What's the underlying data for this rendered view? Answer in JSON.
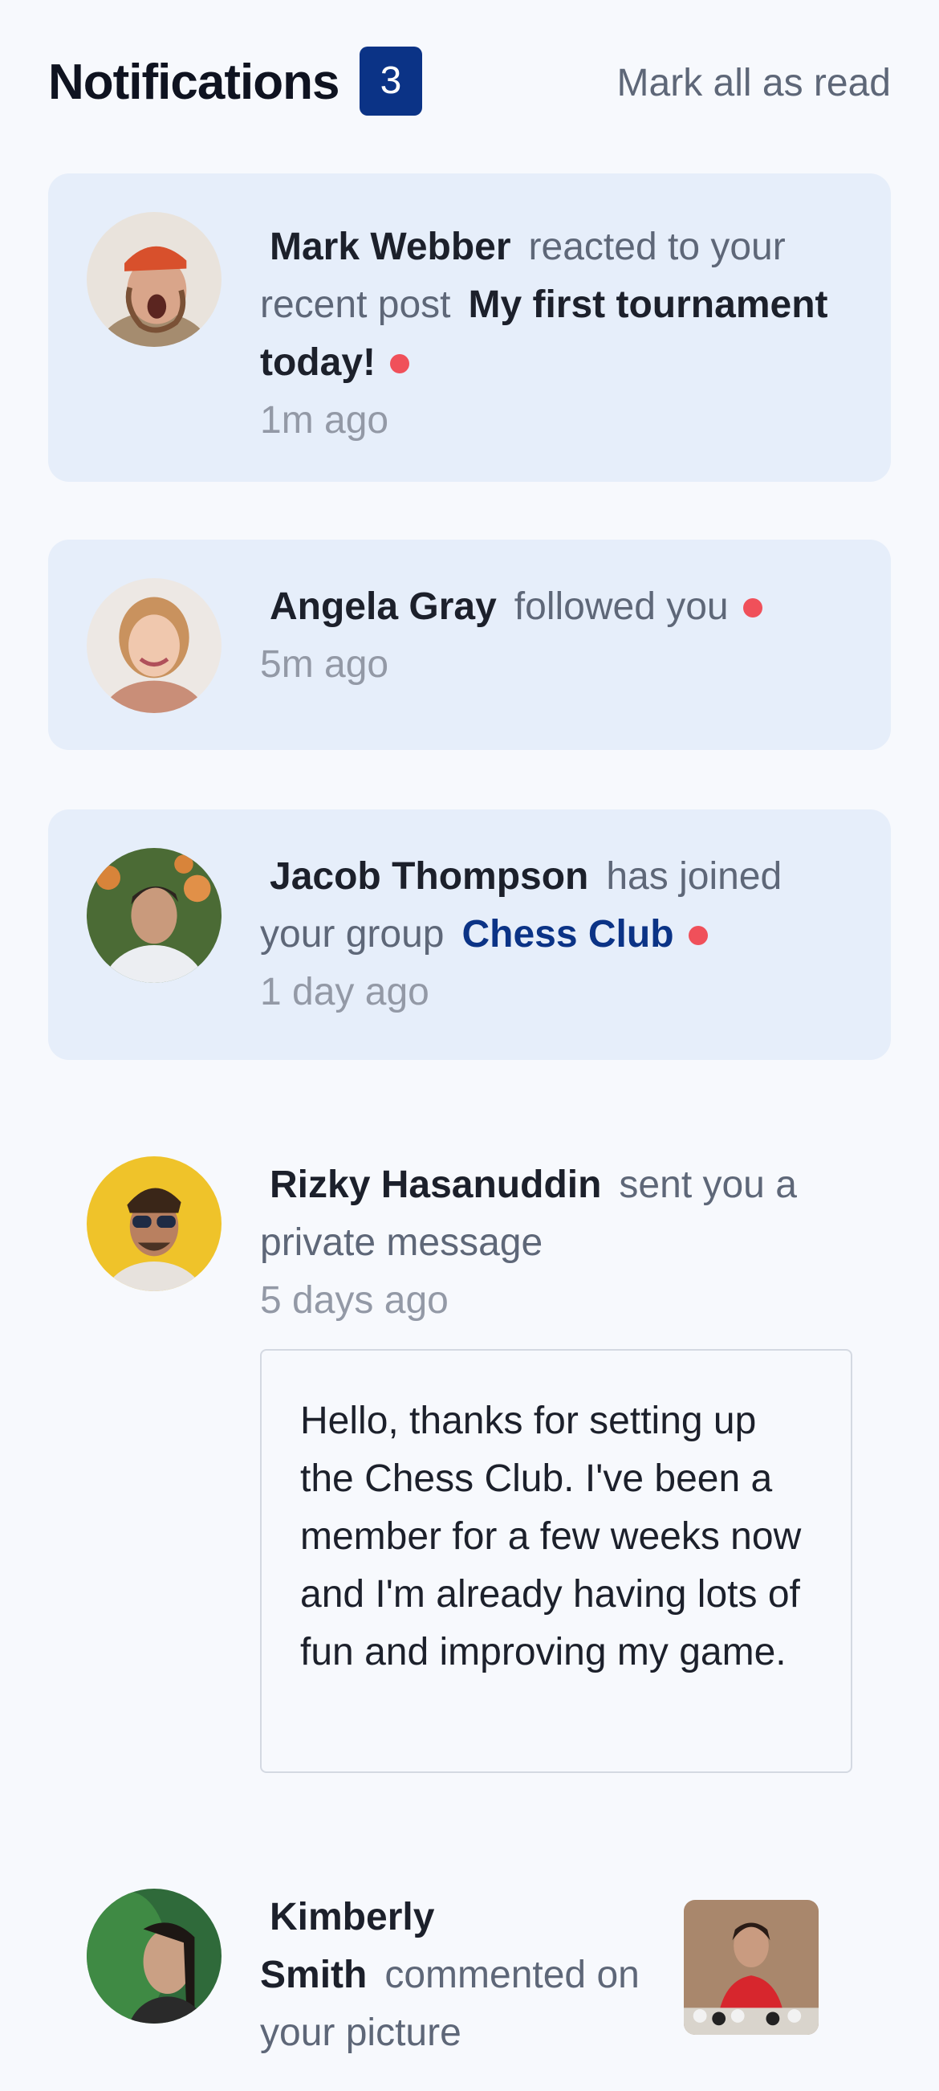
{
  "header": {
    "title": "Notifications",
    "unread_count": "3",
    "mark_all_label": "Mark all as read"
  },
  "notifications": [
    {
      "user": "Mark Webber",
      "action": "reacted to your recent post",
      "object": "My first tournament today!",
      "time": "1m ago",
      "unread": true
    },
    {
      "user": "Angela Gray",
      "action": "followed you",
      "time": "5m ago",
      "unread": true
    },
    {
      "user": "Jacob Thompson",
      "action": "has joined your group",
      "object": "Chess Club",
      "time": "1 day ago",
      "unread": true
    },
    {
      "user": "Rizky Hasanuddin",
      "action": "sent you a private message",
      "time": "5 days ago",
      "message": "Hello, thanks for setting up the Chess Club. I've been a member for a few weeks now and I'm already having lots of fun and improving my game.",
      "unread": false
    },
    {
      "user": "Kimberly Smith",
      "action": "commented on your picture",
      "unread": false
    }
  ],
  "colors": {
    "accent": "#0b3386",
    "unread_bg": "#e6eefa",
    "unread_dot": "#f0505a",
    "page_bg": "#f7f9fd"
  }
}
